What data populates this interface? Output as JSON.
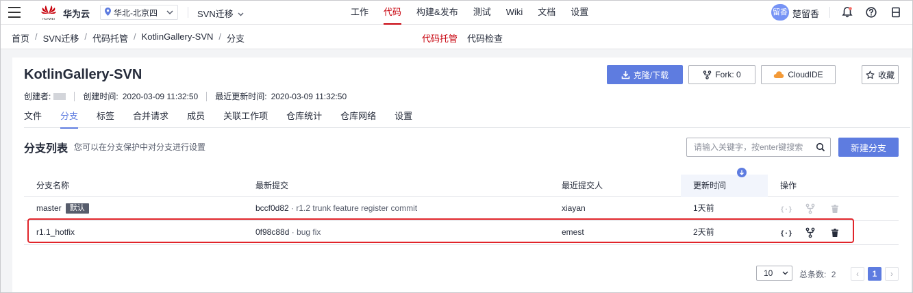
{
  "topbar": {
    "brand": "华为云",
    "logo_subtext": "HUAWEI",
    "region": "华北-北京四",
    "project": "SVN迁移",
    "nav": [
      {
        "label": "工作"
      },
      {
        "label": "代码",
        "active": true
      },
      {
        "label": "构建&发布"
      },
      {
        "label": "测试"
      },
      {
        "label": "Wiki"
      },
      {
        "label": "文档"
      },
      {
        "label": "设置"
      }
    ],
    "avatar_text": "留香",
    "username": "楚留香",
    "icons": [
      "bell-icon",
      "help-icon",
      "panel-icon"
    ]
  },
  "breadcrumb": [
    "首页",
    "SVN迁移",
    "代码托管",
    "KotlinGallery-SVN",
    "分支"
  ],
  "subnav": [
    {
      "label": "代码托管",
      "active": true
    },
    {
      "label": "代码检查"
    }
  ],
  "repo": {
    "title": "KotlinGallery-SVN",
    "creator_label": "创建者:",
    "created_label": "创建时间:",
    "created_value": "2020-03-09 11:32:50",
    "updated_label": "最近更新时间:",
    "updated_value": "2020-03-09 11:32:50"
  },
  "actions": {
    "clone": "克隆/下载",
    "fork": "Fork: 0",
    "cloudide": "CloudIDE",
    "favorite": "收藏"
  },
  "tabs": [
    {
      "label": "文件"
    },
    {
      "label": "分支",
      "active": true
    },
    {
      "label": "标签"
    },
    {
      "label": "合并请求"
    },
    {
      "label": "成员"
    },
    {
      "label": "关联工作项"
    },
    {
      "label": "仓库统计"
    },
    {
      "label": "仓库网络"
    },
    {
      "label": "设置"
    }
  ],
  "branches": {
    "title": "分支列表",
    "description": "您可以在分支保护中对分支进行设置",
    "search_placeholder": "请输入关键字，按enter键搜索",
    "new_button": "新建分支",
    "columns": {
      "name": "分支名称",
      "commit": "最新提交",
      "committer": "最近提交人",
      "updated": "更新时间",
      "ops": "操作"
    },
    "rows": [
      {
        "name": "master",
        "badge": "默认",
        "hash": "bccf0d82",
        "message": "r1.2 trunk feature register commit",
        "committer": "xiayan",
        "updated": "1天前",
        "actions_enabled": false
      },
      {
        "name": "r1.1_hotfix",
        "badge": "",
        "hash": "0f98c88d",
        "message": "bug fix",
        "committer": "emest",
        "updated": "2天前",
        "actions_enabled": true
      }
    ],
    "commit_separator": "·"
  },
  "pagination": {
    "page_size": "10",
    "total_label": "总条数:",
    "total_value": "2",
    "current_page": "1",
    "prev": "‹",
    "next": "›"
  },
  "colors": {
    "brand_red": "#c7000b",
    "primary_blue": "#5e7ce0",
    "highlight_red": "#e0242a"
  }
}
